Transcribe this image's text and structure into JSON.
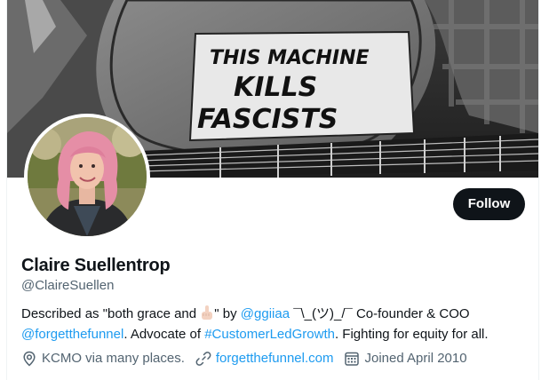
{
  "banner": {
    "sign_lines": [
      "THIS MACHINE",
      "KILLS",
      "FASCISTS"
    ]
  },
  "profile": {
    "follow_label": "Follow",
    "name": "Claire Suellentrop",
    "handle": "@ClaireSuellen",
    "bio": {
      "part1": "Described as \"both grace and ",
      "part2": "\" by ",
      "mention_ggiiaa": "@ggiiaa",
      "part3": " ¯\\_(ツ)_/¯ Co-founder & COO",
      "mention_forgetthefunnel": "@forgetthefunnel",
      "part4": ". Advocate of ",
      "hashtag": "#CustomerLedGrowth",
      "part5": ". Fighting for equity for all."
    },
    "location": "KCMO via many places.",
    "website": "forgetthefunnel.com",
    "joined": "Joined April 2010"
  },
  "icons": {
    "emoji": "middle-finger-emoji",
    "location": "location-pin-icon",
    "website": "link-icon",
    "joined": "calendar-icon"
  },
  "colors": {
    "link": "#1d9bf0",
    "secondary_text": "#536471",
    "follow_button": "#0f1419"
  }
}
